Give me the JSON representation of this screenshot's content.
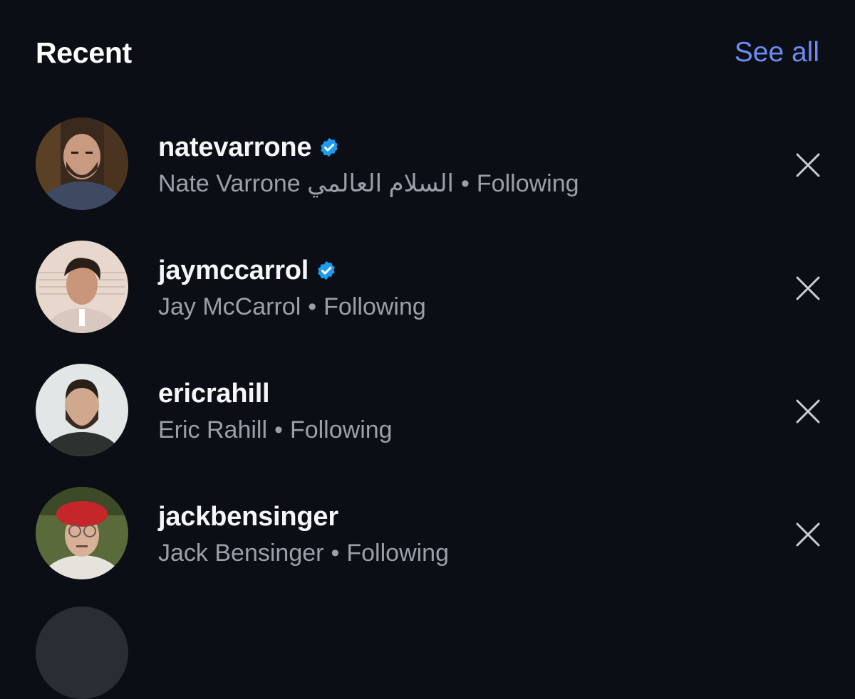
{
  "header": {
    "title": "Recent",
    "see_all_label": "See all",
    "accent_color": "#6b8df5"
  },
  "icons": {
    "verified": "verified-badge-icon",
    "dismiss": "close-icon"
  },
  "verified_color": "#1d9bf0",
  "separator": "•",
  "recent_items": [
    {
      "username": "natevarrone",
      "verified": true,
      "display_name": "Nate Varrone السلام العالمي",
      "status": "Following"
    },
    {
      "username": "jaymccarrol",
      "verified": true,
      "display_name": "Jay McCarrol",
      "status": "Following"
    },
    {
      "username": "ericrahill",
      "verified": false,
      "display_name": "Eric Rahill",
      "status": "Following"
    },
    {
      "username": "jackbensinger",
      "verified": false,
      "display_name": "Jack Bensinger",
      "status": "Following"
    }
  ]
}
